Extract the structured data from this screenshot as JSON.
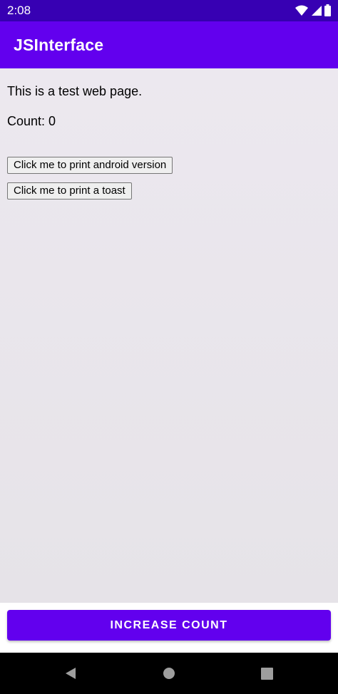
{
  "status_bar": {
    "time": "2:08",
    "icons": [
      "wifi-icon",
      "signal-icon",
      "battery-icon"
    ]
  },
  "app_bar": {
    "title": "JSInterface"
  },
  "webview": {
    "heading": "This is a test web page.",
    "count_text": "Count: 0",
    "buttons": [
      {
        "label": "Click me to print android version"
      },
      {
        "label": "Click me to print a toast"
      }
    ]
  },
  "action": {
    "increase_label": "INCREASE COUNT"
  },
  "navigation": {
    "icons": [
      "back-icon",
      "home-icon",
      "recents-icon"
    ]
  },
  "colors": {
    "status_bar": "#3700b3",
    "primary": "#6200ee",
    "webview_bg": "#e8e4ea"
  }
}
